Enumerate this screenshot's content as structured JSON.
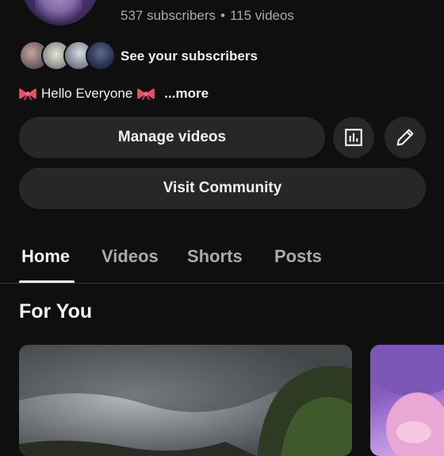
{
  "channel": {
    "subscribers": "537 subscribers",
    "separator": "•",
    "videos": "115 videos",
    "see_subscribers": "See your subscribers",
    "description": "Hello Everyone",
    "more": "...more"
  },
  "actions": {
    "manage_videos": "Manage videos",
    "visit_community": "Visit Community"
  },
  "tabs": [
    {
      "label": "Home",
      "active": true
    },
    {
      "label": "Videos",
      "active": false
    },
    {
      "label": "Shorts",
      "active": false
    },
    {
      "label": "Posts",
      "active": false
    }
  ],
  "section": {
    "title": "For You"
  },
  "icons": {
    "analytics": "bar-chart-icon",
    "edit": "pencil-icon",
    "bow": "ribbon-bow-icon"
  },
  "colors": {
    "background": "#0f0f0f",
    "button": "#272727",
    "text": "#f1f1f1",
    "muted": "#aaaaaa"
  }
}
